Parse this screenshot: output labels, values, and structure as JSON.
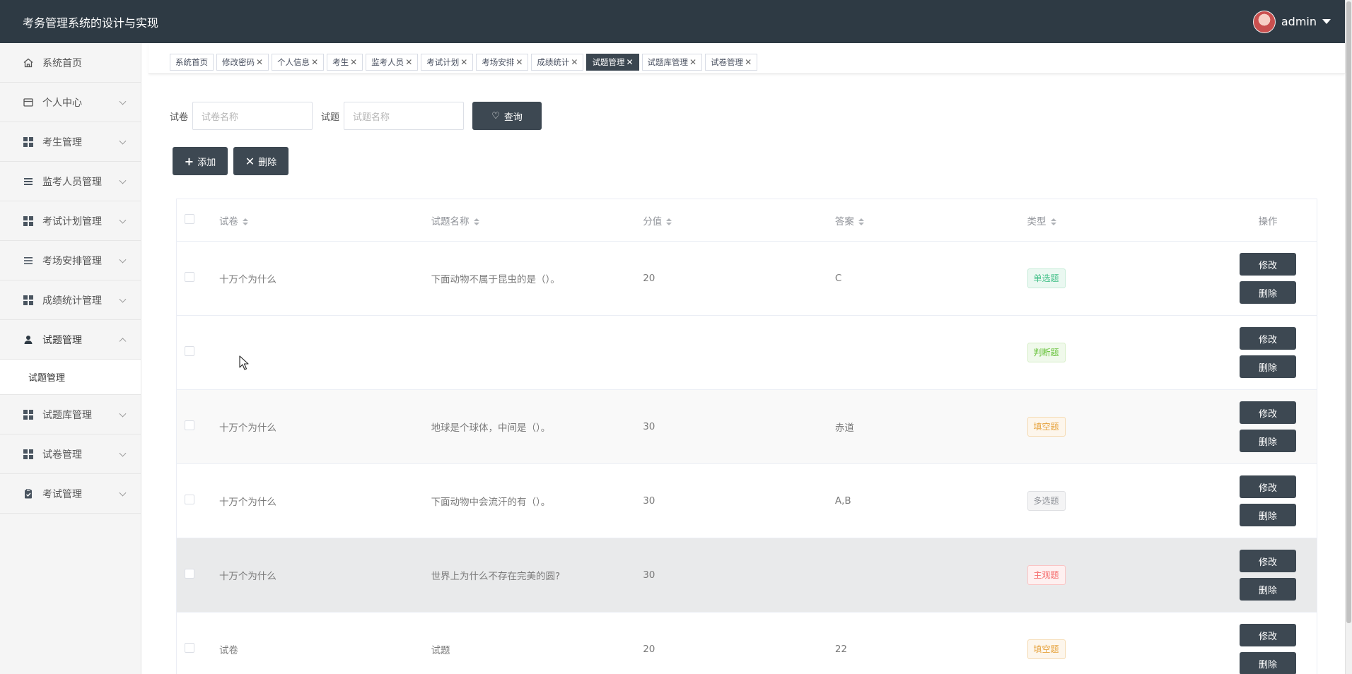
{
  "app": {
    "title": "考务管理系统的设计与实现",
    "user": "admin"
  },
  "sidebar": {
    "items": [
      {
        "label": "系统首页",
        "icon": "home-icon"
      },
      {
        "label": "个人中心",
        "icon": "card-icon"
      },
      {
        "label": "考生管理",
        "icon": "grid-icon"
      },
      {
        "label": "监考人员管理",
        "icon": "list-icon"
      },
      {
        "label": "考试计划管理",
        "icon": "grid-icon"
      },
      {
        "label": "考场安排管理",
        "icon": "list-icon"
      },
      {
        "label": "成绩统计管理",
        "icon": "grid-icon"
      },
      {
        "label": "试题管理",
        "icon": "user-icon"
      },
      {
        "label": "试题库管理",
        "icon": "grid-icon"
      },
      {
        "label": "试卷管理",
        "icon": "grid-icon"
      },
      {
        "label": "考试管理",
        "icon": "clipboard-icon"
      }
    ],
    "submenu": {
      "label": "试题管理"
    }
  },
  "tabs": [
    "系统首页",
    "修改密码",
    "个人信息",
    "考生",
    "监考人员",
    "考试计划",
    "考场安排",
    "成绩统计",
    "试题管理",
    "试题库管理",
    "试卷管理"
  ],
  "search": {
    "paper_label": "试卷",
    "paper_placeholder": "试卷名称",
    "question_label": "试题",
    "question_placeholder": "试题名称",
    "query_button": "查询"
  },
  "actions": {
    "add": "添加",
    "delete": "删除"
  },
  "table": {
    "headers": [
      "试卷",
      "试题名称",
      "分值",
      "答案",
      "类型",
      "操作"
    ],
    "edit_label": "修改",
    "delete_label": "删除",
    "rows": [
      {
        "paper": "十万个为什么",
        "question": "下面动物不属于昆虫的是（）。",
        "score": "20",
        "answer": "C",
        "type": "单选题",
        "tag_color": "#42c088"
      },
      {
        "paper": "",
        "question": "",
        "score": "",
        "answer": "",
        "type": "判断题",
        "tag_color": "#67c23a"
      },
      {
        "paper": "十万个为什么",
        "question": "地球是个球体，中间是（）。",
        "score": "30",
        "answer": "赤道",
        "type": "填空题",
        "tag_color": "#e6a23c"
      },
      {
        "paper": "十万个为什么",
        "question": "下面动物中会流汗的有（）。",
        "score": "30",
        "answer": "A,B",
        "type": "多选题",
        "tag_color": "#909399"
      },
      {
        "paper": "十万个为什么",
        "question": "世界上为什么不存在完美的圆?",
        "score": "30",
        "answer": "",
        "type": "主观题",
        "tag_color": "#f56c6c"
      },
      {
        "paper": "试卷",
        "question": "试题",
        "score": "20",
        "answer": "22",
        "type": "填空题",
        "tag_color": "#e6a23c"
      }
    ]
  }
}
